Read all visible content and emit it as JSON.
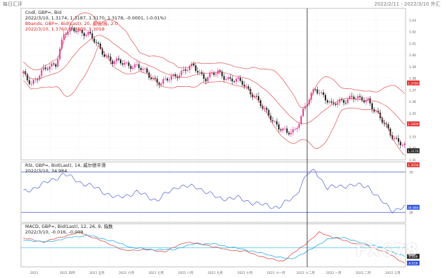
{
  "app": {
    "name": "每日汇评",
    "timestamp": "2022/2/11 - 2022/3/10 外汇"
  },
  "legend": {
    "main": "Cndl, GBP=, Bid",
    "main_values": "2022/3/10, 1.3174, 1.3187, 1.3170, 1.3178, -0.0001, (-0.01%)",
    "bb": "Bbands, GBP=, Bid(Last), 20, 最低/高, 2.0",
    "bb_values": "2022/3/10, 1.3760, 1.3409, 1.3058",
    "rsi": "RSI, GBP=, Bid(Last), 14, 威尔德平滑",
    "rsi_values": "2022/3/10, 34.984",
    "macd": "MACD, GBP=, Bid(Last), 12, 26, 9, 指数",
    "macd_values": "2022/3/10, -0.016, -0.009"
  },
  "colors": {
    "up": "#e0409a",
    "down": "#222222",
    "bb": "#e05050",
    "rsi": "#4d5fd6",
    "macd": "#e05050",
    "signal": "#29a8e6",
    "grid": "#cccccc",
    "cursor": "#333333",
    "tag_red": "#e03030",
    "tag_dark": "#222222",
    "tag_blue": "#3355dd"
  },
  "watermark": "FX678",
  "chart_data": [
    {
      "type": "candlestick",
      "title": "GBP= Daily",
      "y_range": [
        1.31,
        1.44
      ],
      "y_ticks": [
        "1.43",
        "1.42",
        "1.41",
        "1.40",
        "1.39",
        "1.38",
        "1.37",
        "1.36",
        "1.35",
        "1.34",
        "1.33",
        "1.32",
        "1.31"
      ],
      "x_labels": [
        "2021",
        "2021 四月",
        "2021 五月",
        "2021 六月",
        "2021 七月",
        "2021 八月",
        "2021 九月",
        "2021 十月",
        "2021 十一月",
        "2021 十二月",
        "2022 一月",
        "2022 二月",
        "2022 三月"
      ],
      "price_path": [
        [
          0,
          1.383
        ],
        [
          4,
          1.376
        ],
        [
          9,
          1.385
        ],
        [
          16,
          1.393
        ],
        [
          20,
          1.418
        ],
        [
          26,
          1.422
        ],
        [
          32,
          1.418
        ],
        [
          38,
          1.405
        ],
        [
          44,
          1.394
        ],
        [
          50,
          1.393
        ],
        [
          56,
          1.39
        ],
        [
          62,
          1.383
        ],
        [
          68,
          1.375
        ],
        [
          74,
          1.382
        ],
        [
          80,
          1.387
        ],
        [
          84,
          1.39
        ],
        [
          90,
          1.38
        ],
        [
          96,
          1.385
        ],
        [
          102,
          1.379
        ],
        [
          108,
          1.376
        ],
        [
          114,
          1.365
        ],
        [
          118,
          1.354
        ],
        [
          122,
          1.347
        ],
        [
          126,
          1.338
        ],
        [
          130,
          1.332
        ],
        [
          134,
          1.336
        ],
        [
          138,
          1.352
        ],
        [
          144,
          1.371
        ],
        [
          148,
          1.366
        ],
        [
          152,
          1.356
        ],
        [
          156,
          1.36
        ],
        [
          162,
          1.364
        ],
        [
          166,
          1.361
        ],
        [
          170,
          1.362
        ],
        [
          176,
          1.345
        ],
        [
          182,
          1.331
        ],
        [
          188,
          1.321
        ]
      ],
      "bb_period": 20,
      "bb_mult": 2.0,
      "cursor_index": 140,
      "last_value": "1.3178",
      "value_tags": [
        {
          "value": "1.3760",
          "y": 1.376,
          "color": "tag_red"
        },
        {
          "value": "1.3409",
          "y": 1.3409,
          "color": "tag_red"
        },
        {
          "value": "1.3178",
          "y": 1.3178,
          "color": "tag_dark"
        },
        {
          "value": "1.3058",
          "y": 1.3058,
          "color": "tag_red"
        }
      ]
    },
    {
      "type": "line",
      "title": "RSI 14",
      "y_range": [
        20,
        80
      ],
      "levels": [
        70,
        30
      ],
      "series": [
        {
          "name": "RSI",
          "path": [
            [
              0,
              50
            ],
            [
              10,
              58
            ],
            [
              20,
              68
            ],
            [
              28,
              60
            ],
            [
              36,
              54
            ],
            [
              46,
              44
            ],
            [
              56,
              50
            ],
            [
              66,
              42
            ],
            [
              76,
              56
            ],
            [
              86,
              55
            ],
            [
              96,
              44
            ],
            [
              106,
              44
            ],
            [
              116,
              38
            ],
            [
              126,
              35
            ],
            [
              134,
              46
            ],
            [
              140,
              68
            ],
            [
              144,
              71
            ],
            [
              150,
              54
            ],
            [
              160,
              57
            ],
            [
              170,
              56
            ],
            [
              176,
              42
            ],
            [
              182,
              32
            ],
            [
              188,
              35
            ]
          ]
        }
      ],
      "last_value": "34.984"
    },
    {
      "type": "line",
      "title": "MACD 12 26 9",
      "y_range": [
        -0.02,
        0.025
      ],
      "zero": 0,
      "series": [
        {
          "name": "MACD",
          "path": [
            [
              0,
              0.01
            ],
            [
              10,
              0.006
            ],
            [
              20,
              0.012
            ],
            [
              28,
              0.016
            ],
            [
              40,
              0.006
            ],
            [
              50,
              -0.003
            ],
            [
              60,
              -0.002
            ],
            [
              70,
              -0.004
            ],
            [
              80,
              0.006
            ],
            [
              90,
              0.003
            ],
            [
              100,
              -0.002
            ],
            [
              110,
              -0.004
            ],
            [
              120,
              -0.011
            ],
            [
              128,
              -0.014
            ],
            [
              138,
              0.002
            ],
            [
              146,
              0.016
            ],
            [
              154,
              0.01
            ],
            [
              164,
              0.004
            ],
            [
              170,
              0.002
            ],
            [
              178,
              -0.004
            ],
            [
              188,
              -0.016
            ]
          ]
        },
        {
          "name": "Signal",
          "path": [
            [
              0,
              0.008
            ],
            [
              12,
              0.006
            ],
            [
              24,
              0.011
            ],
            [
              32,
              0.013
            ],
            [
              44,
              0.007
            ],
            [
              54,
              0.0
            ],
            [
              64,
              -0.002
            ],
            [
              74,
              -0.002
            ],
            [
              84,
              0.004
            ],
            [
              94,
              0.004
            ],
            [
              104,
              0.0
            ],
            [
              114,
              -0.004
            ],
            [
              124,
              -0.009
            ],
            [
              132,
              -0.012
            ],
            [
              140,
              -0.004
            ],
            [
              150,
              0.009
            ],
            [
              158,
              0.011
            ],
            [
              166,
              0.005
            ],
            [
              174,
              0.002
            ],
            [
              188,
              -0.009
            ]
          ]
        }
      ],
      "value_tags": [
        {
          "value": "-0.009",
          "y": -0.009,
          "color": "tag_dark"
        },
        {
          "value": "-0.016",
          "y": -0.016,
          "color": "tag_blue"
        }
      ]
    }
  ]
}
